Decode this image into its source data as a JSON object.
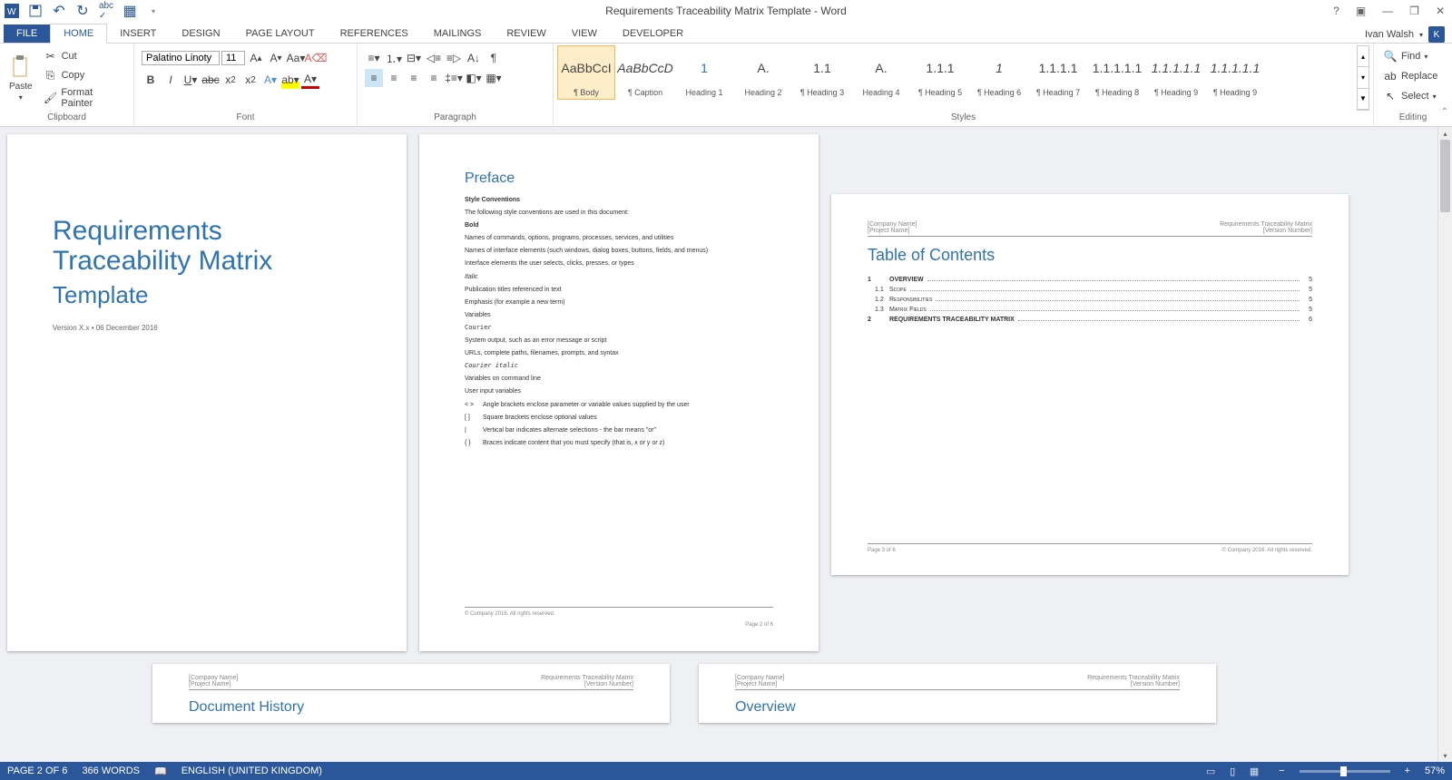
{
  "titlebar": {
    "title": "Requirements Traceability Matrix Template - Word"
  },
  "user": {
    "name": "Ivan Walsh",
    "initial": "K"
  },
  "tabs": [
    "FILE",
    "HOME",
    "INSERT",
    "DESIGN",
    "PAGE LAYOUT",
    "REFERENCES",
    "MAILINGS",
    "REVIEW",
    "VIEW",
    "DEVELOPER"
  ],
  "clipboard": {
    "paste": "Paste",
    "cut": "Cut",
    "copy": "Copy",
    "format_painter": "Format Painter",
    "label": "Clipboard"
  },
  "font": {
    "name": "Palatino Linoty",
    "size": "11",
    "label": "Font"
  },
  "paragraph": {
    "label": "Paragraph"
  },
  "styles": {
    "label": "Styles",
    "items": [
      {
        "prev": "AaBbCcI",
        "name": "¶ Body",
        "sel": true,
        "color": "#444",
        "style": "normal"
      },
      {
        "prev": "AaBbCcD",
        "name": "¶ Caption",
        "color": "#444",
        "style": "italic"
      },
      {
        "prev": "1",
        "name": "Heading 1",
        "color": "#2e74b5",
        "style": "300"
      },
      {
        "prev": "A.",
        "name": "Heading 2",
        "color": "#444",
        "style": "normal"
      },
      {
        "prev": "1.1",
        "name": "¶ Heading 3",
        "color": "#444",
        "style": "normal"
      },
      {
        "prev": "A.",
        "name": "Heading 4",
        "color": "#444",
        "style": "normal"
      },
      {
        "prev": "1.1.1",
        "name": "¶ Heading 5",
        "color": "#444",
        "style": "normal"
      },
      {
        "prev": "1",
        "name": "¶ Heading 6",
        "color": "#444",
        "style": "italic"
      },
      {
        "prev": "1.1.1.1",
        "name": "¶ Heading 7",
        "color": "#444",
        "style": "normal"
      },
      {
        "prev": "1.1.1.1.1",
        "name": "¶ Heading 8",
        "color": "#444",
        "style": "normal"
      },
      {
        "prev": "1.1.1.1.1",
        "name": "¶ Heading 9",
        "color": "#444",
        "style": "italic"
      },
      {
        "prev": "1.1.1.1.1",
        "name": "¶ Heading 9",
        "color": "#444",
        "style": "italic"
      }
    ]
  },
  "editing": {
    "find": "Find",
    "replace": "Replace",
    "select": "Select",
    "label": "Editing"
  },
  "page1": {
    "title1": "Requirements",
    "title2": "Traceability Matrix",
    "sub": "Template",
    "ver": "Version X.x • 06 December 2016"
  },
  "page2": {
    "h": "Preface",
    "p1": "Style Conventions",
    "p2": "The following style conventions are used in this document:",
    "p3": "Bold",
    "p4": "Names of commands, options, programs, processes, services, and utilities",
    "p5": "Names of interface elements (such windows, dialog boxes, buttons, fields, and menus)",
    "p6": "Interface elements the user selects, clicks, presses, or types",
    "p7": "Italic",
    "p8": "Publication titles referenced in text",
    "p9": "Emphasis (for example a new term)",
    "p10": "Variables",
    "p11": "Courier",
    "p12": "System output, such as an error message or script",
    "p13": "URLs, complete paths, filenames, prompts, and syntax",
    "p14": "Courier italic",
    "p15": "Variables on command line",
    "p16": "User input variables",
    "b1s": "< >",
    "b1t": "Angle brackets enclose parameter or variable values supplied by the user",
    "b2s": "[ ]",
    "b2t": "Square brackets enclose optional values",
    "b3s": "|",
    "b3t": "Vertical bar indicates alternate selections - the bar means \"or\"",
    "b4s": "{ }",
    "b4t": "Braces indicate content that you must specify (that is, x or y or z)",
    "footL": "© Company 2016. All rights reserved.",
    "footR": "Page 2 of 6"
  },
  "page3": {
    "hL1": "[Company Name]",
    "hL2": "[Project Name]",
    "hR1": "Requirements Traceability Matrix",
    "hR2": "[Version Number]",
    "h": "Table of Contents",
    "toc": [
      {
        "n": "1",
        "t": "OVERVIEW",
        "p": "5",
        "cls": "main"
      },
      {
        "n": "1.1",
        "t": "Scope",
        "p": "5",
        "cls": "sub"
      },
      {
        "n": "1.2",
        "t": "Responsibilities",
        "p": "5",
        "cls": "sub"
      },
      {
        "n": "1.3",
        "t": "Matrix Fields",
        "p": "5",
        "cls": "sub"
      },
      {
        "n": "2",
        "t": "REQUIREMENTS TRACEABILITY MATRIX",
        "p": "6",
        "cls": "main"
      }
    ],
    "footL": "Page 3 of 6",
    "footR": "© Company 2016. All rights reserved."
  },
  "page4": {
    "hL1": "[Company Name]",
    "hL2": "[Project Name]",
    "hR1": "Requirements Traceability Matrix",
    "hR2": "[Version Number]",
    "h": "Document History"
  },
  "page5": {
    "hL1": "[Company Name]",
    "hL2": "[Project Name]",
    "hR1": "Requirements Traceability Matrix",
    "hR2": "[Version Number]",
    "h": "Overview"
  },
  "status": {
    "page": "PAGE 2 OF 6",
    "words": "366 WORDS",
    "lang": "ENGLISH (UNITED KINGDOM)",
    "zoom": "57%"
  }
}
